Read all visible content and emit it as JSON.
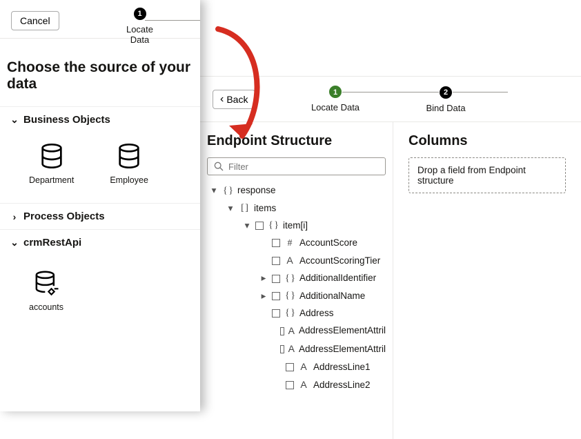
{
  "left": {
    "cancel": "Cancel",
    "step1": "1",
    "step1_label": "Locate Data",
    "title": "Choose the source of your data",
    "sections": {
      "business": {
        "label": "Business Objects",
        "items": [
          "Department",
          "Employee"
        ]
      },
      "process": {
        "label": "Process Objects"
      },
      "crm": {
        "label": "crmRestApi",
        "items": [
          "accounts"
        ]
      }
    }
  },
  "right": {
    "back": "Back",
    "steps": [
      {
        "num": "1",
        "label": "Locate Data"
      },
      {
        "num": "2",
        "label": "Bind Data"
      }
    ],
    "endpoint_title": "Endpoint Structure",
    "filter_placeholder": "Filter",
    "columns_title": "Columns",
    "drop_text": "Drop a field from Endpoint structure",
    "tree": {
      "response": "response",
      "items": "items",
      "item_i": "item[i]",
      "nodes": [
        {
          "kind": "hash",
          "label": "AccountScore"
        },
        {
          "kind": "a",
          "label": "AccountScoringTier"
        },
        {
          "kind": "curly",
          "label": "AdditionalIdentifier",
          "expandable": true
        },
        {
          "kind": "curly",
          "label": "AdditionalName",
          "expandable": true
        },
        {
          "kind": "curly",
          "label": "Address"
        },
        {
          "kind": "a",
          "label": "AddressElementAttril",
          "deep": true
        },
        {
          "kind": "a",
          "label": "AddressElementAttril",
          "deep": true
        },
        {
          "kind": "a",
          "label": "AddressLine1",
          "deep": true
        },
        {
          "kind": "a",
          "label": "AddressLine2",
          "deep": true
        }
      ]
    }
  }
}
